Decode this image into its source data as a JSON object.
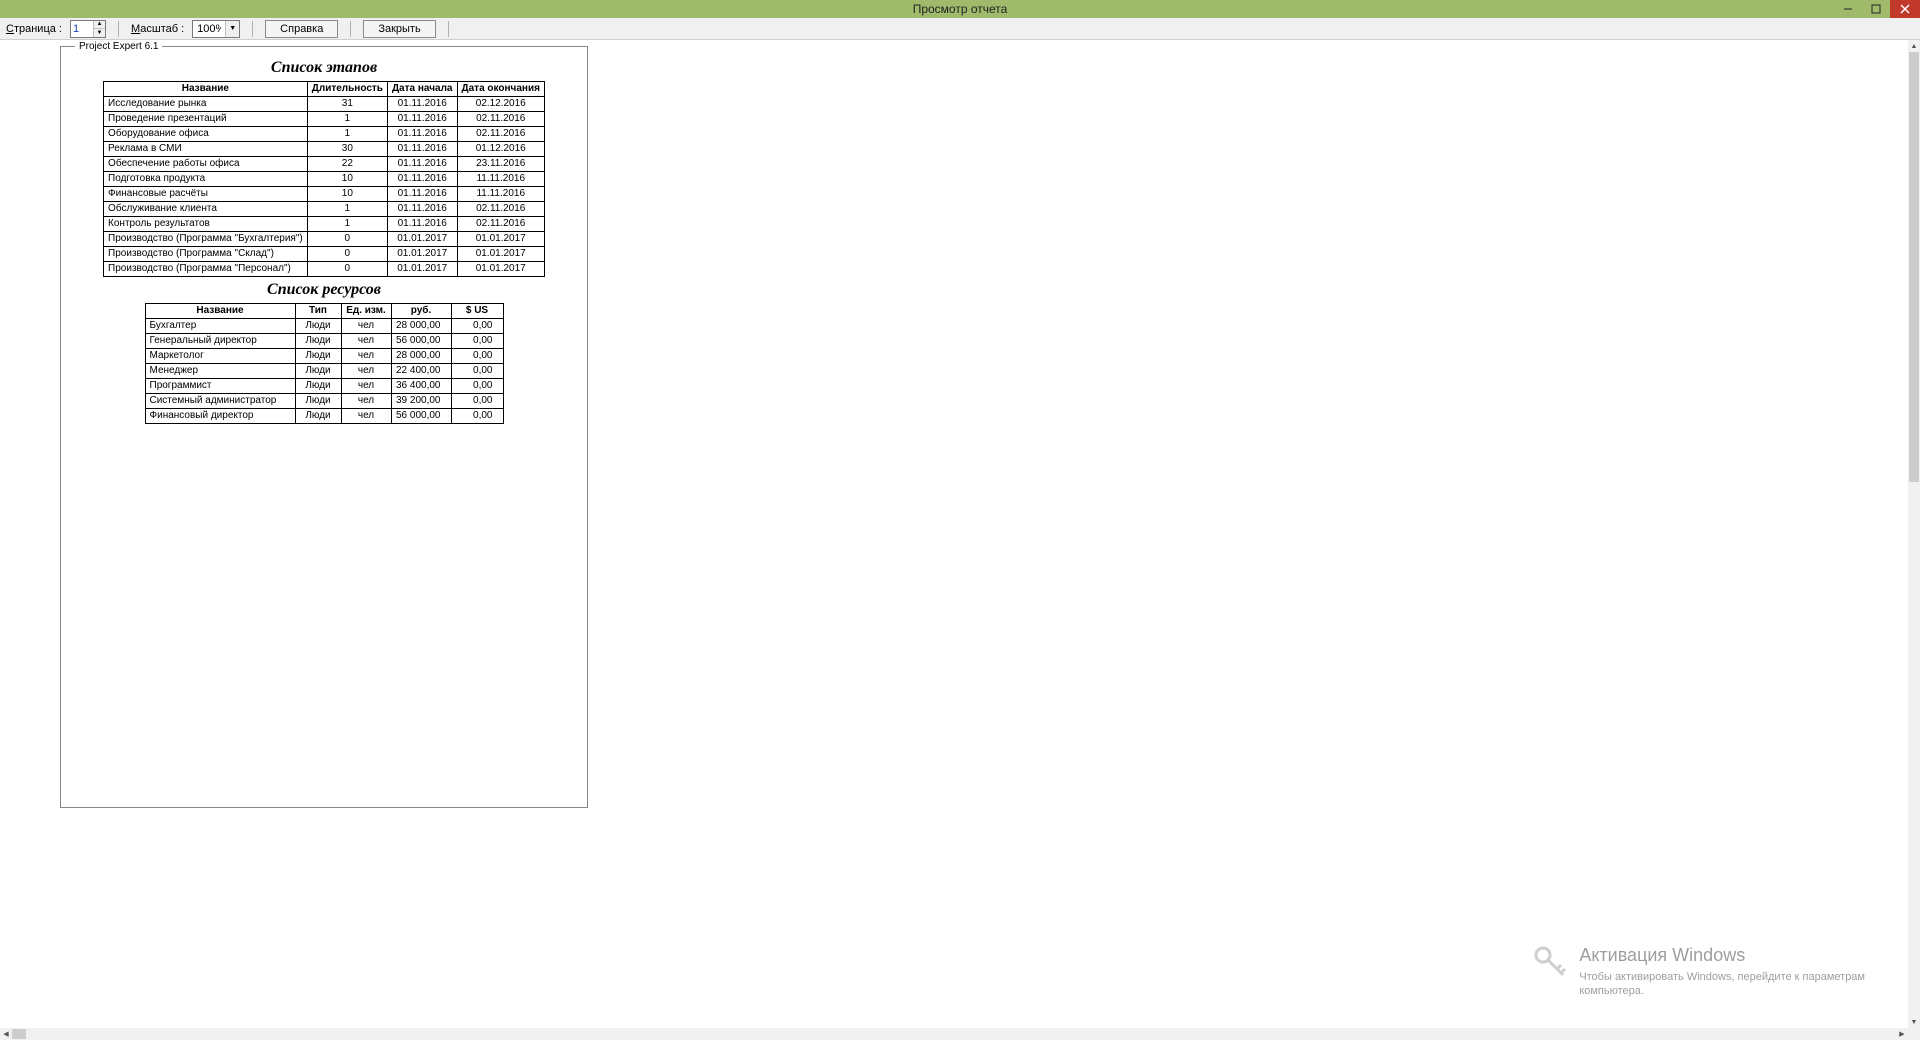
{
  "window": {
    "title": "Просмотр отчета"
  },
  "toolbar": {
    "page_label": "Страница :",
    "page_value": "1",
    "zoom_label": "Масштаб :",
    "zoom_value": "100%",
    "help_label": "Справка",
    "close_label": "Закрыть"
  },
  "page": {
    "legend": "Project Expert 6.1",
    "stages_title": "Список этапов",
    "stages_headers": [
      "Название",
      "Длительность",
      "Дата начала",
      "Дата окончания"
    ],
    "stages_rows": [
      [
        "Исследование рынка",
        "31",
        "01.11.2016",
        "02.12.2016"
      ],
      [
        "Проведение презентаций",
        "1",
        "01.11.2016",
        "02.11.2016"
      ],
      [
        "Оборудование офиса",
        "1",
        "01.11.2016",
        "02.11.2016"
      ],
      [
        "Реклама в СМИ",
        "30",
        "01.11.2016",
        "01.12.2016"
      ],
      [
        "Обеспечение работы офиса",
        "22",
        "01.11.2016",
        "23.11.2016"
      ],
      [
        "Подготовка продукта",
        "10",
        "01.11.2016",
        "11.11.2016"
      ],
      [
        "Финансовые расчёты",
        "10",
        "01.11.2016",
        "11.11.2016"
      ],
      [
        "Обслуживание клиента",
        "1",
        "01.11.2016",
        "02.11.2016"
      ],
      [
        "Контроль результатов",
        "1",
        "01.11.2016",
        "02.11.2016"
      ],
      [
        "Производство (Программа \"Бухгалтерия\")",
        "0",
        "01.01.2017",
        "01.01.2017"
      ],
      [
        "Производство (Программа \"Склад\")",
        "0",
        "01.01.2017",
        "01.01.2017"
      ],
      [
        "Производство (Программа \"Персонал\")",
        "0",
        "01.01.2017",
        "01.01.2017"
      ]
    ],
    "resources_title": "Список ресурсов",
    "resources_headers": [
      "Название",
      "Тип",
      "Ед. изм.",
      "руб.",
      "$ US"
    ],
    "resources_rows": [
      [
        "Бухгалтер",
        "Люди",
        "чел",
        "28 000,00",
        "0,00"
      ],
      [
        "Генеральный директор",
        "Люди",
        "чел",
        "56 000,00",
        "0,00"
      ],
      [
        "Маркетолог",
        "Люди",
        "чел",
        "28 000,00",
        "0,00"
      ],
      [
        "Менеджер",
        "Люди",
        "чел",
        "22 400,00",
        "0,00"
      ],
      [
        "Программист",
        "Люди",
        "чел",
        "36 400,00",
        "0,00"
      ],
      [
        "Системный администратор",
        "Люди",
        "чел",
        "39 200,00",
        "0,00"
      ],
      [
        "Финансовый директор",
        "Люди",
        "чел",
        "56 000,00",
        "0,00"
      ]
    ]
  },
  "watermark": {
    "line1": "Активация Windows",
    "line2": "Чтобы активировать Windows, перейдите к параметрам",
    "line3": "компьютера."
  }
}
